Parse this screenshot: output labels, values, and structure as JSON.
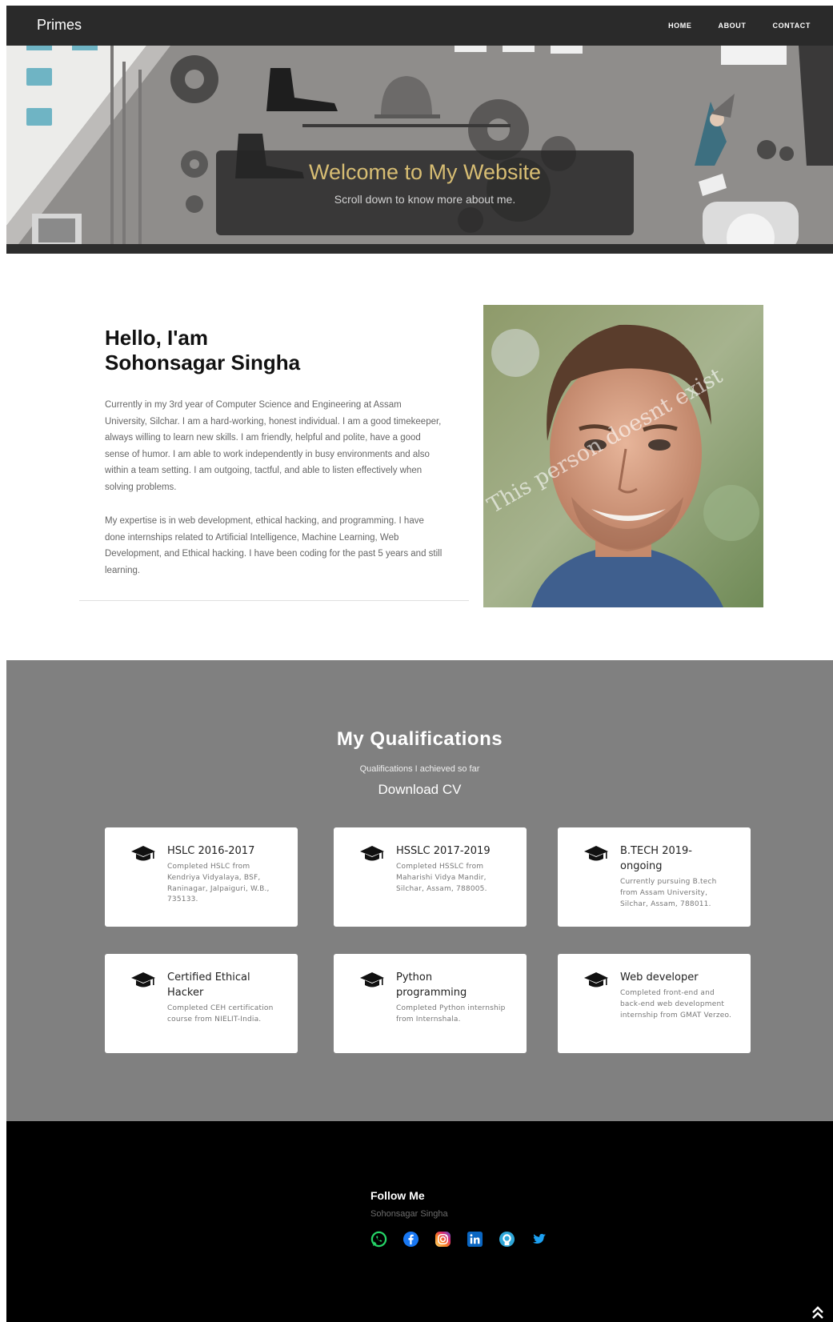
{
  "nav": {
    "brand": "Primes",
    "links": [
      "HOME",
      "ABOUT",
      "CONTACT"
    ]
  },
  "hero": {
    "title": "Welcome to My Website",
    "subtitle": "Scroll down to know more about me."
  },
  "about": {
    "greeting": "Hello, I'am",
    "name": "Sohonsagar Singha",
    "paragraph1": "Currently in my 3rd year of Computer Science and Engineering at Assam University, Silchar. I am a hard-working, honest individual. I am a good timekeeper, always willing to learn new skills. I am friendly, helpful and polite, have a good sense of humor. I am able to work independently in busy environments and also within a team setting. I am outgoing, tactful, and able to listen effectively when solving problems.",
    "paragraph2": "My expertise is in web development, ethical hacking, and programming. I have done internships related to Artificial Intelligence, Machine Learning, Web Development, and Ethical hacking. I have been coding for the past 5 years and still learning.",
    "photo_watermark": "This person doesnt exist"
  },
  "qualifications": {
    "title": "My Qualifications",
    "subtitle": "Qualifications I achieved so far",
    "download_label": "Download CV",
    "cards": [
      {
        "title": "HSLC 2016-2017",
        "text": "Completed HSLC from Kendriya Vidyalaya, BSF, Raninagar, Jalpaiguri, W.B., 735133.",
        "icon": "graduation-cap-icon"
      },
      {
        "title": "HSSLC 2017-2019",
        "text": "Completed HSSLC from Maharishi Vidya Mandir, Silchar, Assam, 788005.",
        "icon": "graduation-cap-icon"
      },
      {
        "title": "B.TECH 2019-ongoing",
        "text": "Currently pursuing B.tech from Assam University, Silchar, Assam, 788011.",
        "icon": "graduation-cap-icon"
      },
      {
        "title": "Certified Ethical Hacker",
        "text": "Completed CEH certification course from NIELIT-India.",
        "icon": "graduation-cap-icon"
      },
      {
        "title": "Python programming",
        "text": "Completed Python internship from Internshala.",
        "icon": "graduation-cap-icon"
      },
      {
        "title": "Web developer",
        "text": "Completed front-end and back-end web development internship from GMAT Verzeo.",
        "icon": "graduation-cap-icon"
      }
    ]
  },
  "footer": {
    "follow_label": "Follow Me",
    "name": "Sohonsagar Singha",
    "socials": [
      "whatsapp-icon",
      "facebook-icon",
      "instagram-icon",
      "linkedin-icon",
      "github-icon",
      "twitter-icon"
    ]
  },
  "colors": {
    "nav_bg": "#2a2a2a",
    "hero_title": "#d7bd73",
    "quals_bg": "#808080",
    "footer_bg": "#000000"
  }
}
